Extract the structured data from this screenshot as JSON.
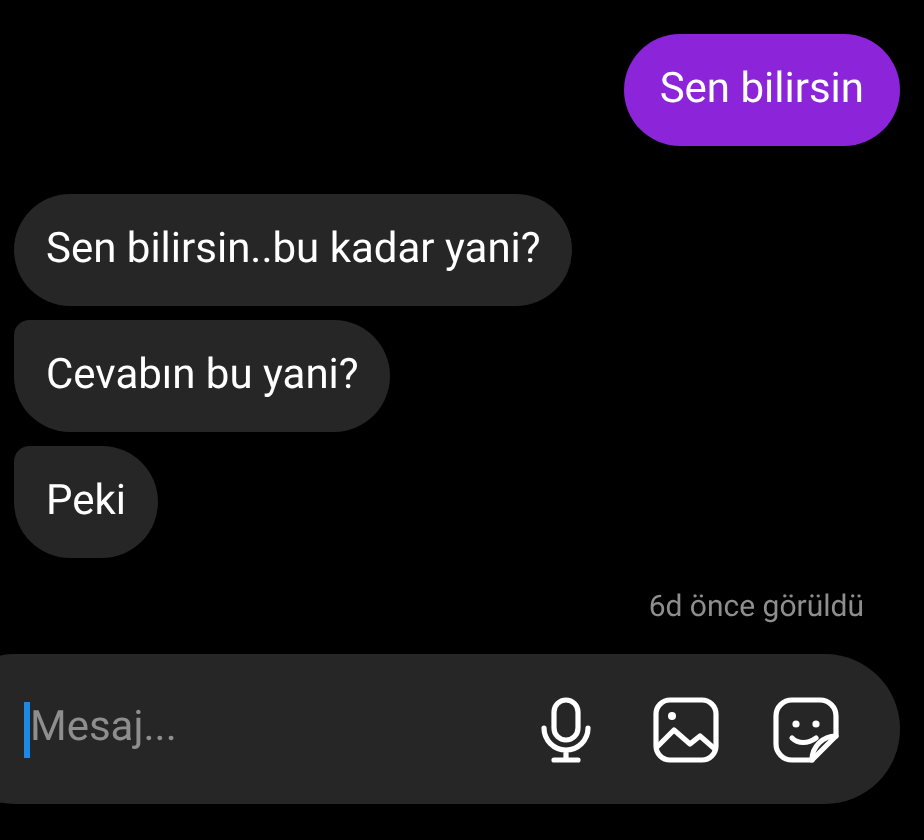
{
  "messages": [
    {
      "kind": "outgoing",
      "text": "Sen bilirsin"
    },
    {
      "kind": "incoming",
      "text": "Sen bilirsin..bu kadar yani?"
    },
    {
      "kind": "incoming",
      "text": "Cevabın bu yani?"
    },
    {
      "kind": "incoming",
      "text": "Peki"
    }
  ],
  "seen_status": "6d önce görüldü",
  "composer": {
    "placeholder": "Mesaj..."
  }
}
